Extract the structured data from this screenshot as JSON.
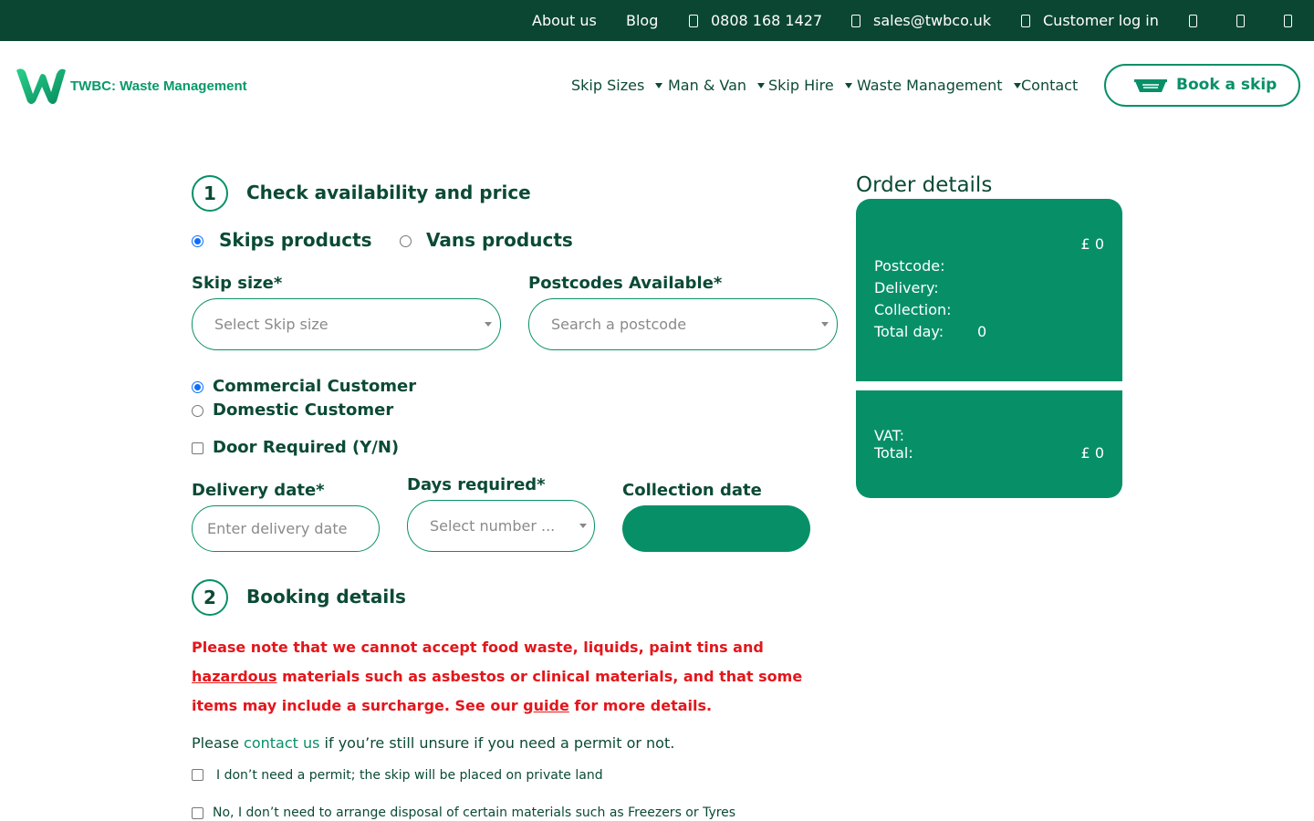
{
  "topbar": {
    "about": "About us",
    "blog": "Blog",
    "phone": "0808 168 1427",
    "email": "sales@twbco.uk",
    "login": "Customer log in"
  },
  "header": {
    "logo_text": "TWBC: Waste Management",
    "nav": [
      "Skip Sizes",
      "Man & Van",
      "Skip Hire",
      "Waste Management",
      "Contact"
    ],
    "book_button": "Book a skip"
  },
  "step1": {
    "number": "1",
    "title": "Check availability and price",
    "product_types": [
      "Skips products",
      "Vans products"
    ],
    "selected_product": "Skips products",
    "skip_size_label": "Skip size*",
    "skip_size_placeholder": "Select Skip size",
    "postcode_label": "Postcodes Available*",
    "postcode_placeholder": "Search a postcode",
    "customer_types": [
      "Commercial Customer",
      "Domestic Customer"
    ],
    "selected_customer": "Commercial Customer",
    "door_required": "Door Required (Y/N)",
    "delivery_label": "Delivery date*",
    "delivery_placeholder": "Enter delivery date",
    "days_label": "Days required*",
    "days_placeholder": "Select number ...",
    "collection_label": "Collection date"
  },
  "order": {
    "title": "Order details",
    "price": "£ 0",
    "postcode_label": "Postcode:",
    "delivery_label": "Delivery:",
    "collection_label": "Collection:",
    "total_day_label": "Total day:",
    "total_day_value": "0",
    "vat_label": "VAT:",
    "total_label": "Total:",
    "total_value": "£ 0"
  },
  "step2": {
    "number": "2",
    "title": "Booking details",
    "warning_part1": "Please note that we cannot accept food waste, liquids, paint tins and ",
    "warning_link1": "hazardous",
    "warning_part2": " materials such as asbestos or clinical materials, and that some items may include a surcharge. See our ",
    "warning_link2": "guide",
    "warning_part3": " for more details.",
    "note_pre": "Please ",
    "note_link": "contact us",
    "note_post": " if you’re still unsure if you need a permit or not.",
    "checkbox_permit": "I don’t need a permit; the skip will be placed on private land",
    "checkbox_disposal": "No, I don’t need to arrange disposal of certain materials such as Freezers or Tyres"
  },
  "colors": {
    "dark_green": "#0b4633",
    "accent_green": "#079068",
    "warning_red": "#e3161b"
  }
}
